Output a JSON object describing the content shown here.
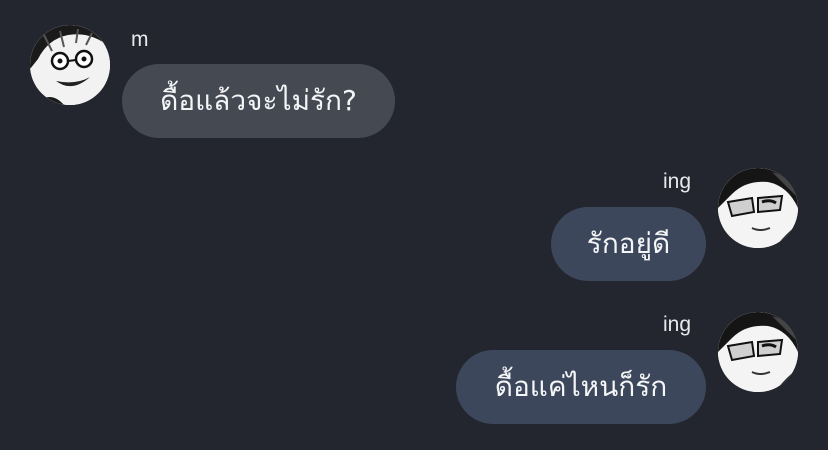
{
  "messages": [
    {
      "sender": "m",
      "text": "ดื้อแล้วจะไม่รัก?",
      "avatar_icon": "manga-face-glasses-avatar"
    },
    {
      "sender": "ing",
      "text": "รักอยู่ดี",
      "avatar_icon": "manga-face-sunglasses-avatar"
    },
    {
      "sender": "ing",
      "text": "ดื้อแค่ไหนก็รัก",
      "avatar_icon": "manga-face-sunglasses-avatar"
    }
  ],
  "colors": {
    "background": "#23262f",
    "incoming_bubble": "#454952",
    "outgoing_bubble": "#3d475b",
    "text": "#f4f5f7"
  }
}
